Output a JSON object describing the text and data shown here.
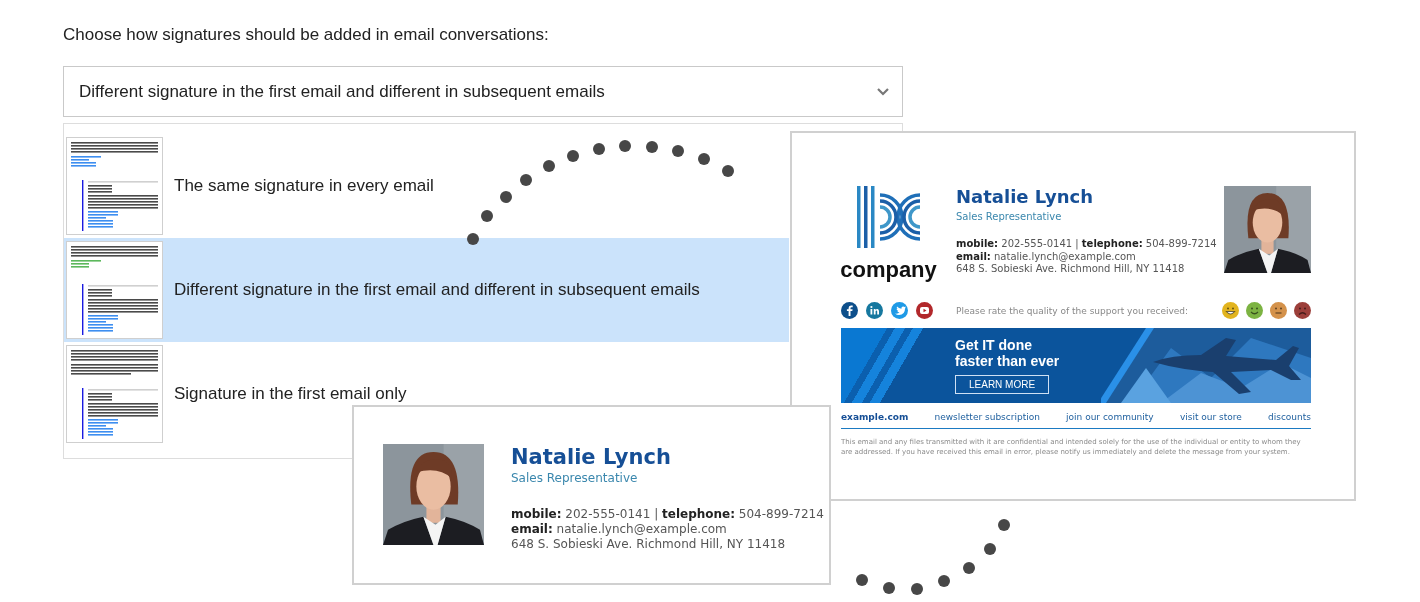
{
  "prompt": "Choose how signatures should be added in email conversations:",
  "dropdown": {
    "value": "Different signature in the first email and different in subsequent emails"
  },
  "options": [
    {
      "kind": "same",
      "label": "The same signature in every email",
      "selected": false
    },
    {
      "kind": "different",
      "label": "Different signature in the first email and different in subsequent emails",
      "selected": true
    },
    {
      "kind": "first_only",
      "label": "Signature in the first email only",
      "selected": false
    }
  ],
  "first_email_signature": {
    "logo_text": "company",
    "name": "Natalie Lynch",
    "title": "Sales Representative",
    "phones": "**mobile:** 202-555-0141  |  **telephone:** 504-899-7214",
    "email": "**email:** natalie.lynch@example.com",
    "address": "648 S. Sobieski Ave. Richmond Hill, NY 11418",
    "rating_prompt": "Please rate the quality of the support you received:",
    "rating_faces": [
      {
        "kind": "grin",
        "color": "#e2b41f"
      },
      {
        "kind": "smile",
        "color": "#7cb342"
      },
      {
        "kind": "neutral",
        "color": "#d4924b"
      },
      {
        "kind": "sad",
        "color": "#9c3f3a"
      }
    ],
    "banner": {
      "headline_lines": [
        "Get IT done",
        "faster than ever"
      ],
      "button": "LEARN MORE"
    },
    "links": [
      {
        "label": "example.com",
        "primary": true
      },
      {
        "label": "newsletter subscription",
        "primary": false
      },
      {
        "label": "join our community",
        "primary": false
      },
      {
        "label": "visit our store",
        "primary": false
      },
      {
        "label": "discounts",
        "primary": false
      }
    ],
    "disclaimer": "This email and any files transmitted with it are confidential and intended solely for the use of the individual or entity to whom they are addressed. If you have received this email in error, please notify us immediately and delete the message from your system."
  },
  "subsequent_email_signature": {
    "name": "Natalie Lynch",
    "title": "Sales Representative",
    "phones": "**mobile:** 202-555-0141  |  **telephone:** 504-899-7214",
    "email": "**email:** natalie.lynch@example.com",
    "address": "648 S. Sobieski Ave. Richmond Hill, NY 11418"
  }
}
